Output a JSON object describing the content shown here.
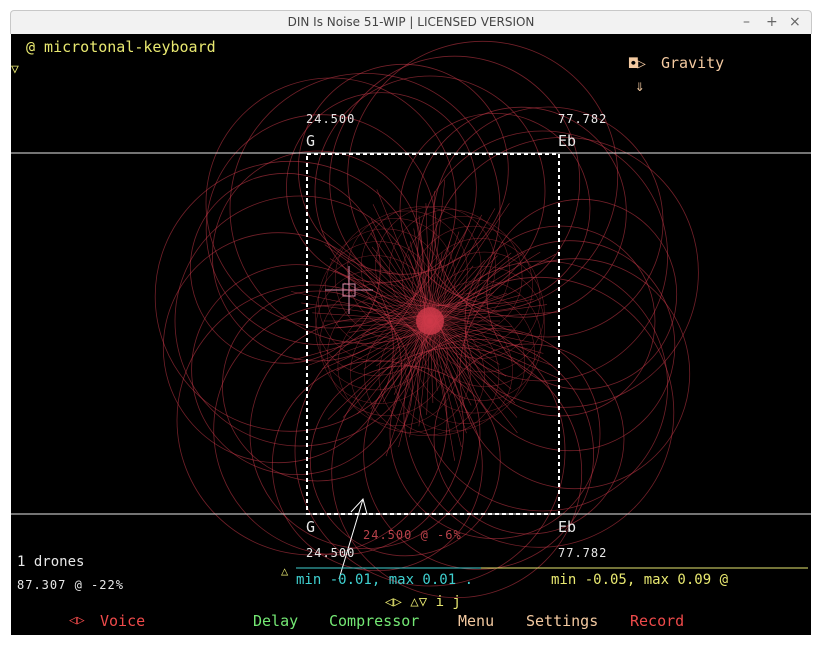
{
  "window": {
    "title": "DIN Is Noise 51-WIP | LICENSED VERSION",
    "minimize_glyph": "–",
    "maximize_glyph": "+",
    "close_glyph": "×"
  },
  "instrument": {
    "label": "@ microtonal-keyboard",
    "collapse_glyph": "▽"
  },
  "gravity": {
    "label": "Gravity",
    "icon_glyph": "◘▷",
    "arrow_glyph": "⇓"
  },
  "top_row": {
    "left_value": "24.500",
    "left_note": "G",
    "right_value": "77.782",
    "right_note": "Eb"
  },
  "bottom_row": {
    "left_note": "G",
    "left_value": "24.500",
    "right_note": "Eb",
    "right_value": "77.782"
  },
  "cursor_readout": "24.500 @ -6%",
  "drones": {
    "count_label": "1 drones",
    "value_label": "87.307 @ -22%"
  },
  "ranges": {
    "up_glyph": "△",
    "cyan_text": "min -0.01, max 0.01 .",
    "yellow_text": "min -0.05, max 0.09 @"
  },
  "nav_glyphs": "◁▷ △▽ i j",
  "menu": {
    "voice_arrows": "◁▷",
    "voice": "Voice",
    "delay": "Delay",
    "compressor": "Compressor",
    "menu": "Menu",
    "settings": "Settings",
    "record": "Record"
  },
  "colors": {
    "background": "#000000",
    "pattern": "#d03a4a",
    "yellow": "#e8e870",
    "green": "#74e874",
    "red": "#ee4a4a",
    "cyan": "#3fd0d0"
  }
}
